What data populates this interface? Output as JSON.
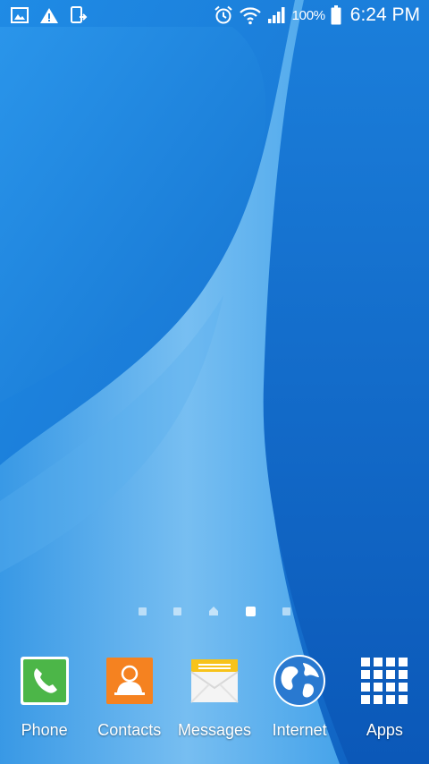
{
  "status_bar": {
    "left_icons": [
      "gallery-icon",
      "warning-icon",
      "screen-mirror-icon"
    ],
    "right_icons": [
      "alarm-icon",
      "wifi-icon",
      "signal-icon",
      "battery-icon"
    ],
    "battery_percent": "100%",
    "time": "6:24 PM"
  },
  "home": {
    "pages": 5,
    "home_page_index": 2,
    "active_page_index": 3
  },
  "dock": {
    "apps": [
      {
        "label": "Phone",
        "icon": "phone-icon",
        "color": "#4cb648"
      },
      {
        "label": "Contacts",
        "icon": "contacts-icon",
        "color": "#f58220"
      },
      {
        "label": "Messages",
        "icon": "messages-icon",
        "color": "#f7c31a"
      },
      {
        "label": "Internet",
        "icon": "globe-icon",
        "color": "#2979d0"
      },
      {
        "label": "Apps",
        "icon": "apps-grid-icon",
        "color": "#ffffff"
      }
    ]
  }
}
